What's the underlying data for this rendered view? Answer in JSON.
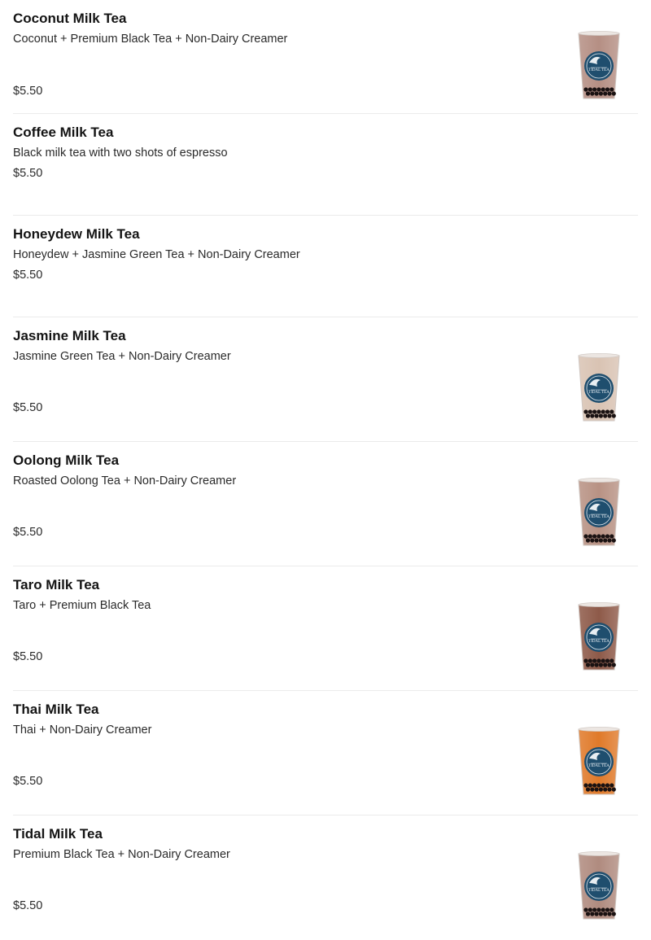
{
  "items": [
    {
      "name": "Coconut Milk Tea",
      "description": "Coconut + Premium Black Tea + Non-Dairy Creamer",
      "price": "$5.50",
      "has_image": true,
      "drink_color": "#b58f84"
    },
    {
      "name": "Coffee Milk Tea",
      "description": "Black milk tea with two shots of espresso",
      "price": "$5.50",
      "has_image": false
    },
    {
      "name": "Honeydew Milk Tea",
      "description": "Honeydew + Jasmine Green Tea + Non-Dairy Creamer",
      "price": "$5.50",
      "has_image": false
    },
    {
      "name": "Jasmine Milk Tea",
      "description": "Jasmine Green Tea + Non-Dairy Creamer",
      "price": "$5.50",
      "has_image": true,
      "drink_color": "#d9c3b3"
    },
    {
      "name": "Oolong Milk Tea",
      "description": "Roasted Oolong Tea + Non-Dairy Creamer",
      "price": "$5.50",
      "has_image": true,
      "drink_color": "#b89284"
    },
    {
      "name": "Taro Milk Tea",
      "description": "Taro + Premium Black Tea",
      "price": "$5.50",
      "has_image": true,
      "drink_color": "#8e5a49"
    },
    {
      "name": "Thai Milk Tea",
      "description": "Thai + Non-Dairy Creamer",
      "price": "$5.50",
      "has_image": true,
      "drink_color": "#e07a2a"
    },
    {
      "name": "Tidal Milk Tea",
      "description": "Premium Black Tea + Non-Dairy Creamer",
      "price": "$5.50",
      "has_image": true,
      "drink_color": "#b08b7f"
    }
  ],
  "cup_logo_text": "TIDAL TEA",
  "colors": {
    "logo": "#1f4e6e",
    "pearls": "#1a1212"
  }
}
